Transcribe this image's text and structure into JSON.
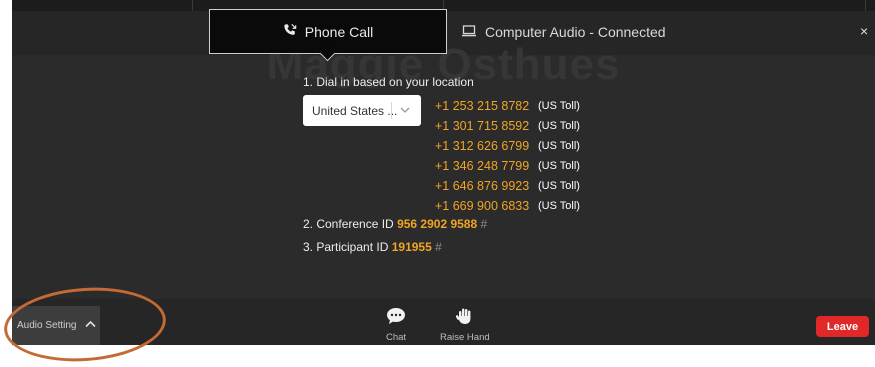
{
  "watermark": "Maggie Osthues",
  "tabs": {
    "phone_label": "Phone Call",
    "computer_label": "Computer Audio - Connected"
  },
  "close_label": "×",
  "dial_in": {
    "step1_label": "1. Dial in based on your location",
    "country_selected": "United States ...",
    "numbers": [
      {
        "number": "+1 253 215 8782",
        "type": "(US Toll)"
      },
      {
        "number": "+1 301 715 8592",
        "type": "(US Toll)"
      },
      {
        "number": "+1 312 626 6799",
        "type": "(US Toll)"
      },
      {
        "number": "+1 346 248 7799",
        "type": "(US Toll)"
      },
      {
        "number": "+1 646 876 9923",
        "type": "(US Toll)"
      },
      {
        "number": "+1 669 900 6833",
        "type": "(US Toll)"
      }
    ],
    "conference_label": "2. Conference ID",
    "conference_id": "956 2902 9588",
    "participant_label": "3. Participant ID",
    "participant_id": "191955",
    "hash_symbol": "#"
  },
  "toolbar": {
    "audio_setting_label": "Audio Setting",
    "chat_label": "Chat",
    "raise_hand_label": "Raise Hand",
    "leave_label": "Leave"
  },
  "colors": {
    "background": "#2b2b2b",
    "accent_number": "#f0a523",
    "leave_button": "#e02828",
    "annotation": "#c46a35"
  },
  "icons": {
    "phone_tab": "phone-icon",
    "computer_tab": "monitor-icon",
    "select": "chevron-down-icon",
    "audio_setting": "chevron-up-icon",
    "chat": "chat-bubble-icon",
    "raise_hand": "hand-icon"
  }
}
